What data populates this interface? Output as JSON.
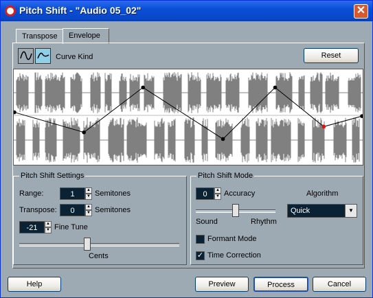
{
  "window": {
    "title": "Pitch Shift - \"Audio 05_02\"",
    "close_glyph": "✕",
    "title_icon": "cubase-logo-icon"
  },
  "tabs": [
    {
      "label": "Transpose",
      "active": false
    },
    {
      "label": "Envelope",
      "active": true
    }
  ],
  "envelope": {
    "curve_kind_label": "Curve Kind",
    "curve_kind_options": [
      "spline-curve-icon",
      "linear-curve-icon"
    ],
    "curve_kind_selected": 1,
    "reset_label": "Reset",
    "envelope_points": [
      [
        0,
        0.45
      ],
      [
        0.2,
        0.66
      ],
      [
        0.37,
        0.19
      ],
      [
        0.6,
        0.73
      ],
      [
        0.75,
        0.19
      ],
      [
        0.89,
        0.6
      ],
      [
        1,
        0.49
      ]
    ],
    "selected_point": 5
  },
  "pitch_shift_settings": {
    "title": "Pitch Shift Settings",
    "range_label": "Range:",
    "range_value": "1",
    "range_unit": "Semitones",
    "transpose_label": "Transpose:",
    "transpose_value": "0",
    "transpose_unit": "Semitones",
    "fine_tune_value": "-21",
    "fine_tune_label": "Fine Tune",
    "cents_label": "Cents",
    "cents_slider_level": 0.42
  },
  "pitch_shift_mode": {
    "title": "Pitch Shift Mode",
    "accuracy_value": "0",
    "accuracy_label": "Accuracy",
    "sound_label": "Sound",
    "rhythm_label": "Rhythm",
    "accuracy_slider_level": 0.5,
    "algorithm_label": "Algorithm",
    "algorithm_value": "Quick",
    "formant_mode_label": "Formant Mode",
    "formant_mode_checked": false,
    "time_correction_label": "Time Correction",
    "time_correction_checked": true,
    "check_glyph": "✓"
  },
  "footer": {
    "help_label": "Help",
    "preview_label": "Preview",
    "process_label": "Process",
    "cancel_label": "Cancel"
  },
  "colors": {
    "window_bg": "#9da9b3",
    "waveform": "#808080",
    "field_bg": "#0a2233",
    "selected_point": "#e01010",
    "curve_btn_active": "#8fd0e8",
    "curve_btn_inactive": "#9da9b3"
  }
}
